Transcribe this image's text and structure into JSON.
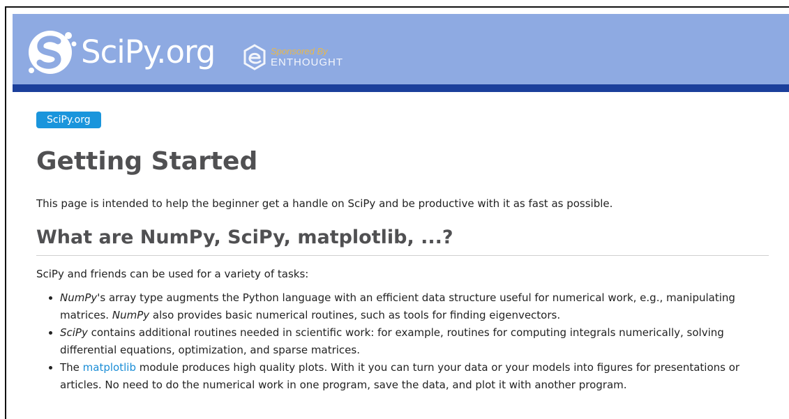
{
  "header": {
    "logo_text": "SciPy.org",
    "sponsor_by": "Sponsored By",
    "sponsor_name": "ENTHOUGHT"
  },
  "breadcrumb": {
    "label": "SciPy.org"
  },
  "main": {
    "title": "Getting Started",
    "intro": "This page is intended to help the beginner get a handle on SciPy and be productive with it as fast as possible.",
    "section_title": "What are NumPy, SciPy, matplotlib, ...?",
    "section_lead": "SciPy and friends can be used for a variety of tasks:",
    "bullets": [
      {
        "em1": "NumPy",
        "text1": "'s array type augments the Python language with an efficient data structure useful for numerical work, e.g., manipulating matrices. ",
        "em2": "NumPy",
        "text2": " also provides basic numerical routines, such as tools for finding eigenvectors."
      },
      {
        "em1": "SciPy",
        "text1": " contains additional routines needed in scientific work: for example, routines for computing integrals numerically, solving differential equations, optimization, and sparse matrices."
      },
      {
        "pre": "The ",
        "link": "matplotlib",
        "text1": " module produces high quality plots. With it you can turn your data or your models into figures for presentations or articles. No need to do the numerical work in one program, save the data, and plot it with another program."
      }
    ]
  },
  "colors": {
    "header_bg": "#8eaae2",
    "header_bar": "#1b3f9b",
    "accent": "#1a95dc",
    "heading": "#505052",
    "sponsor_gold": "#e9b84b"
  },
  "icons": {
    "logo": "scipy-logo-icon",
    "sponsor": "enthought-logo-icon"
  }
}
